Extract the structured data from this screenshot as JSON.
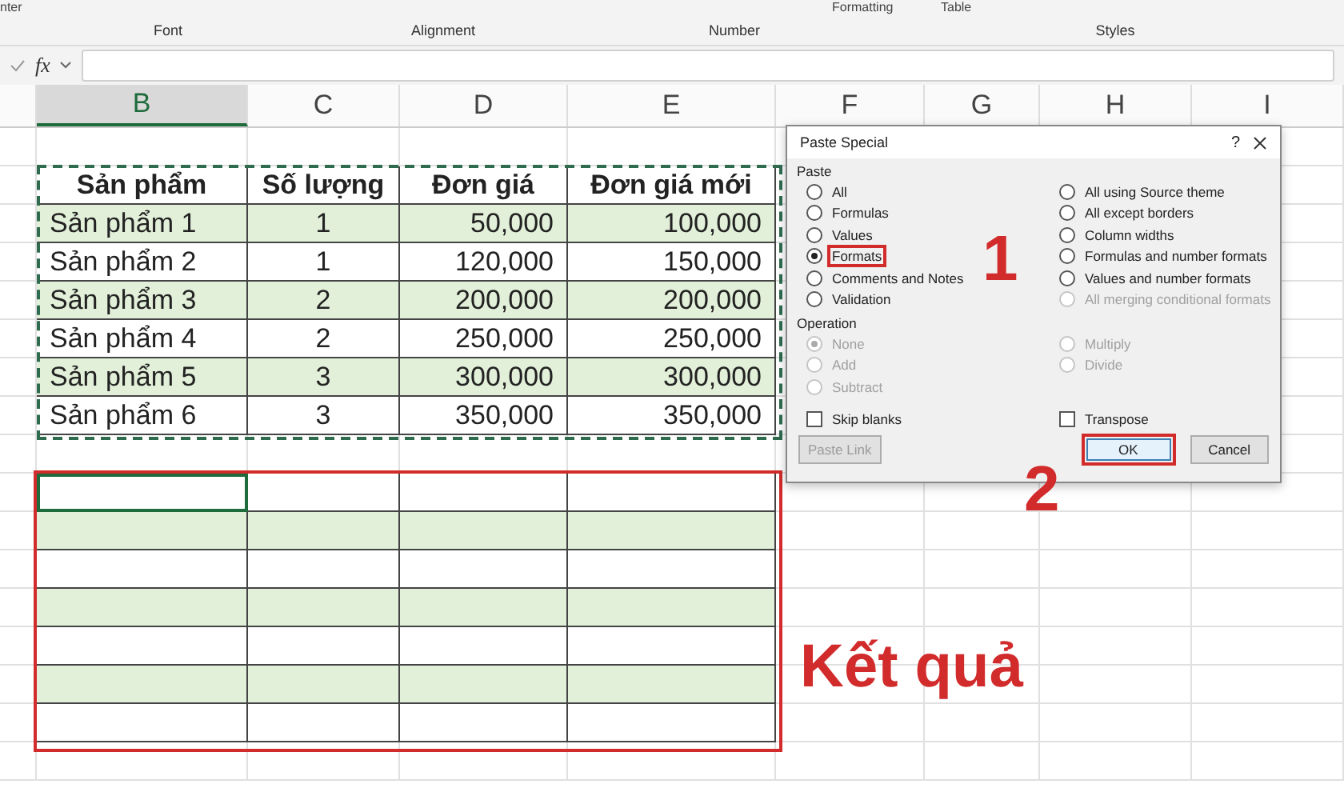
{
  "ribbon": {
    "cut_labels": [
      "nter",
      "Formatting",
      "Table"
    ],
    "groups": [
      "Font",
      "Alignment",
      "Number",
      "Styles"
    ]
  },
  "formula_bar": {
    "fx": "fx"
  },
  "columns": [
    {
      "label": "B",
      "selected": true
    },
    {
      "label": "C",
      "selected": false
    },
    {
      "label": "D",
      "selected": false
    },
    {
      "label": "E",
      "selected": false
    },
    {
      "label": "F",
      "selected": false
    },
    {
      "label": "G",
      "selected": false
    },
    {
      "label": "H",
      "selected": false
    },
    {
      "label": "I",
      "selected": false
    }
  ],
  "table": {
    "columns": [
      "Sản phẩm",
      "Số lượng",
      "Đơn giá",
      "Đơn giá mới"
    ],
    "rows": [
      {
        "cells": [
          "Sản phẩm 1",
          "1",
          "50,000",
          "100,000"
        ],
        "shaded": true
      },
      {
        "cells": [
          "Sản phẩm 2",
          "1",
          "120,000",
          "150,000"
        ],
        "shaded": false
      },
      {
        "cells": [
          "Sản phẩm 3",
          "2",
          "200,000",
          "200,000"
        ],
        "shaded": true
      },
      {
        "cells": [
          "Sản phẩm 4",
          "2",
          "250,000",
          "250,000"
        ],
        "shaded": false
      },
      {
        "cells": [
          "Sản phẩm 5",
          "3",
          "300,000",
          "300,000"
        ],
        "shaded": true
      },
      {
        "cells": [
          "Sản phẩm 6",
          "3",
          "350,000",
          "350,000"
        ],
        "shaded": false
      }
    ]
  },
  "result": {
    "label": "Kết quả",
    "rows": [
      {
        "shaded": false,
        "active": true
      },
      {
        "shaded": true,
        "active": false
      },
      {
        "shaded": false,
        "active": false
      },
      {
        "shaded": true,
        "active": false
      },
      {
        "shaded": false,
        "active": false
      },
      {
        "shaded": true,
        "active": false
      },
      {
        "shaded": false,
        "active": false
      }
    ]
  },
  "dialog": {
    "title": "Paste Special",
    "help": "?",
    "paste_label": "Paste",
    "paste_options": [
      {
        "label": "All",
        "selected": false,
        "disabled": false,
        "highlighted": false
      },
      {
        "label": "Formulas",
        "selected": false,
        "disabled": false,
        "highlighted": false
      },
      {
        "label": "Values",
        "selected": false,
        "disabled": false,
        "highlighted": false
      },
      {
        "label": "Formats",
        "selected": true,
        "disabled": false,
        "highlighted": true
      },
      {
        "label": "Comments and Notes",
        "selected": false,
        "disabled": false,
        "highlighted": false
      },
      {
        "label": "Validation",
        "selected": false,
        "disabled": false,
        "highlighted": false
      },
      {
        "label": "All using Source theme",
        "selected": false,
        "disabled": false,
        "highlighted": false
      },
      {
        "label": "All except borders",
        "selected": false,
        "disabled": false,
        "highlighted": false
      },
      {
        "label": "Column widths",
        "selected": false,
        "disabled": false,
        "highlighted": false
      },
      {
        "label": "Formulas and number formats",
        "selected": false,
        "disabled": false,
        "highlighted": false
      },
      {
        "label": "Values and number formats",
        "selected": false,
        "disabled": false,
        "highlighted": false
      },
      {
        "label": "All merging conditional formats",
        "selected": false,
        "disabled": true,
        "highlighted": false
      }
    ],
    "operation_label": "Operation",
    "operation_options": [
      {
        "label": "None",
        "selected": true,
        "disabled": true
      },
      {
        "label": "Add",
        "selected": false,
        "disabled": true
      },
      {
        "label": "Subtract",
        "selected": false,
        "disabled": true
      },
      {
        "label": "Multiply",
        "selected": false,
        "disabled": true
      },
      {
        "label": "Divide",
        "selected": false,
        "disabled": true
      }
    ],
    "checkboxes": [
      {
        "label": "Skip blanks",
        "checked": false
      },
      {
        "label": "Transpose",
        "checked": false
      }
    ],
    "buttons": [
      {
        "label": "Paste Link",
        "disabled": true,
        "highlighted": false,
        "is_default": false
      },
      {
        "label": "OK",
        "disabled": false,
        "highlighted": true,
        "is_default": true
      },
      {
        "label": "Cancel",
        "disabled": false,
        "highlighted": false,
        "is_default": false
      }
    ]
  },
  "callouts": [
    "1",
    "2"
  ]
}
